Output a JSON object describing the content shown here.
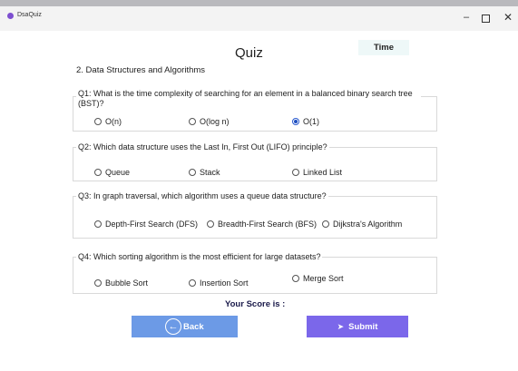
{
  "window": {
    "title": "DsaQuiz",
    "minimize": "–",
    "close": "✕"
  },
  "header": {
    "title": "Quiz",
    "time_label": "Time"
  },
  "section": {
    "title": "2. Data Structures and Algorithms"
  },
  "questions": [
    {
      "text": "Q1: What is the time complexity of searching for an element in a balanced binary search tree (BST)?",
      "options": [
        "O(n)",
        "O(log n)",
        "O(1)"
      ],
      "selected_index": 2
    },
    {
      "text": "Q2: Which data structure uses the Last In, First Out (LIFO) principle?",
      "options": [
        "Queue",
        "Stack",
        "Linked List"
      ],
      "selected_index": null
    },
    {
      "text": "Q3: In graph traversal, which algorithm uses a queue data structure?",
      "options": [
        "Depth-First Search (DFS)",
        "Breadth-First Search (BFS)",
        "Dijkstra's Algorithm"
      ],
      "selected_index": null
    },
    {
      "text": "Q4: Which sorting algorithm is the most efficient for large datasets?",
      "options": [
        "Bubble Sort",
        "Insertion Sort",
        "Merge Sort"
      ],
      "selected_index": null
    }
  ],
  "score": {
    "label": "Your Score  is :"
  },
  "buttons": {
    "back": "Back",
    "submit": "Submit"
  },
  "colors": {
    "back_button": "#6c9ae6",
    "submit_button": "#7b67ea",
    "time_bg": "#eef8f8",
    "radio_selected": "#1f4fbf"
  },
  "icons": {
    "back": "arrow-left-circle-icon",
    "submit": "chevron-right-icon",
    "app": "app-icon"
  }
}
